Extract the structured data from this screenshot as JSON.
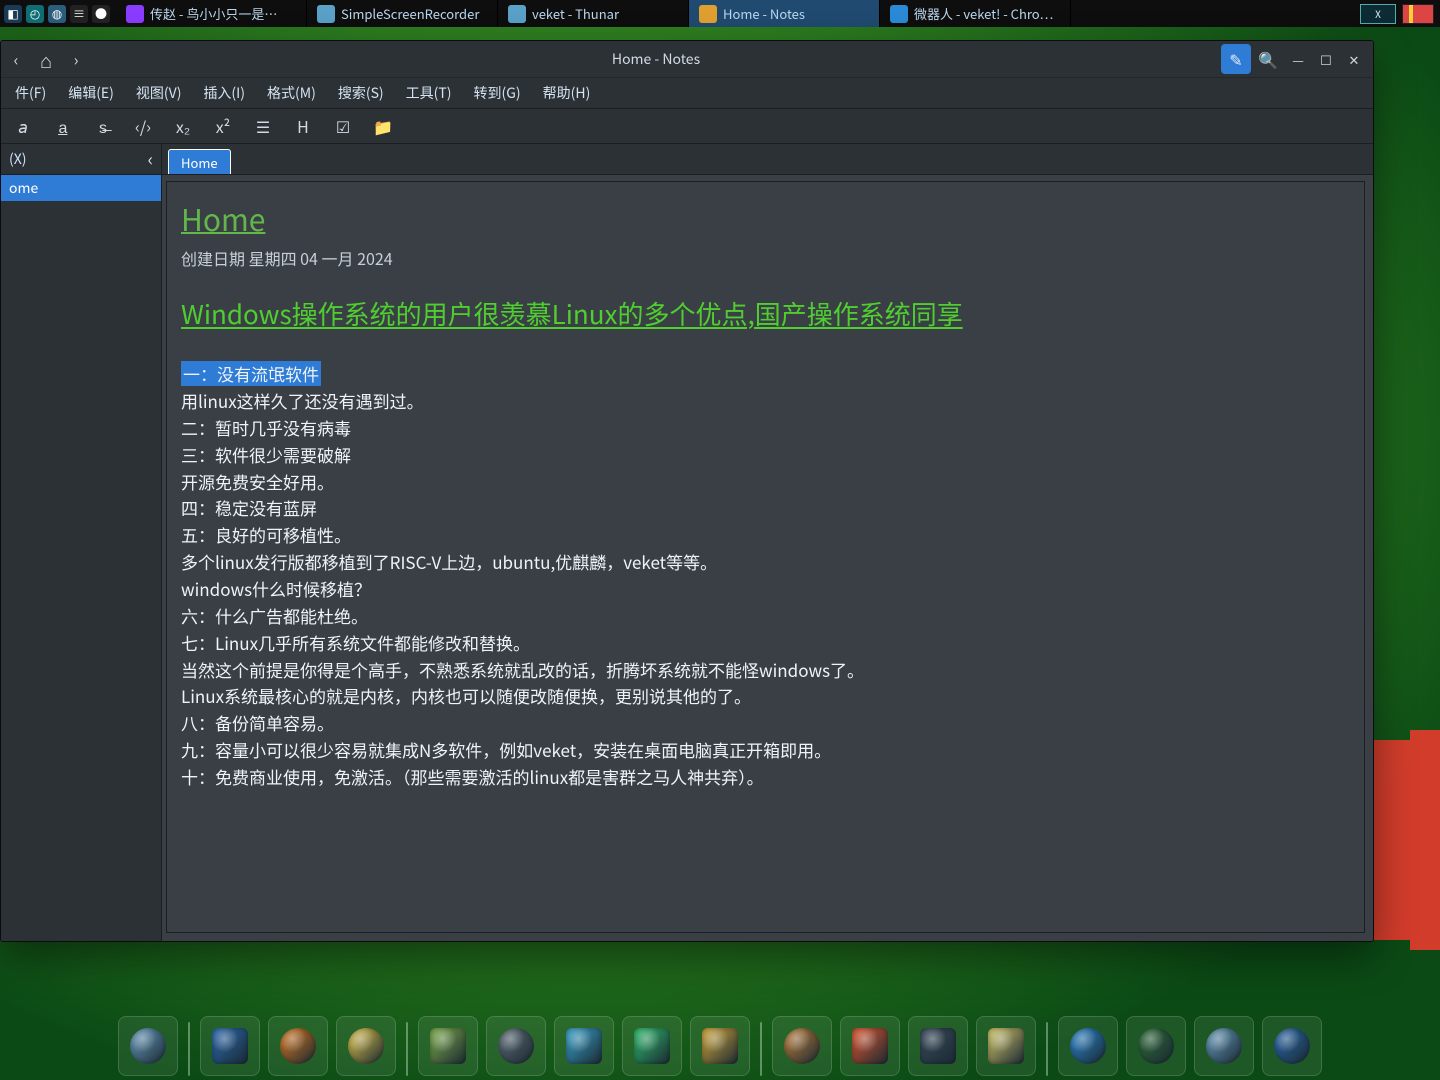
{
  "taskbar": {
    "tasks": [
      {
        "icon": "music-icon",
        "label": "传赵 - 鸟小小只一是…"
      },
      {
        "icon": "folder-icon",
        "label": "SimpleScreenRecorder"
      },
      {
        "icon": "folder-icon",
        "label": "veket - Thunar"
      },
      {
        "icon": "pencil-icon",
        "label": "Home - Notes",
        "active": true
      },
      {
        "icon": "chrome-icon",
        "label": "微器人 - veket! - Chro…"
      }
    ],
    "tray_mon": "X",
    "tray_flag": ""
  },
  "window": {
    "title": "Home - Notes",
    "nav_back_glyph": "‹",
    "nav_home_glyph": "⌂",
    "nav_fwd_glyph": "›",
    "edit_glyph": "✎",
    "search_glyph": "🔍",
    "min_glyph": "—",
    "max_glyph": "☐",
    "close_glyph": "✕"
  },
  "menu": [
    "件(F)",
    "编辑(E)",
    "视图(V)",
    "插入(I)",
    "格式(M)",
    "搜索(S)",
    "工具(T)",
    "转到(G)",
    "帮助(H)"
  ],
  "tools": [
    {
      "name": "italic-icon",
      "g": "𝘢"
    },
    {
      "name": "underline-icon",
      "g": "a̲"
    },
    {
      "name": "strike-icon",
      "g": "s̶"
    },
    {
      "name": "code-icon",
      "g": "‹/›"
    },
    {
      "name": "subscript-icon",
      "g": "x₂"
    },
    {
      "name": "superscript-icon",
      "g": "x²"
    },
    {
      "name": "list-icon",
      "g": "☰"
    },
    {
      "name": "heading-icon",
      "g": "H"
    },
    {
      "name": "task-icon",
      "g": "☑"
    },
    {
      "name": "folder-open-icon",
      "g": "📁"
    }
  ],
  "sidebar": {
    "tab_label": "(X)",
    "collapse_glyph": "‹",
    "items": [
      {
        "label": "ome",
        "selected": true
      }
    ]
  },
  "tabs": [
    {
      "label": "Home"
    }
  ],
  "doc": {
    "title": "Home",
    "date": "创建日期 星期四 04 一月 2024",
    "headline": "Windows操作系统的用户很羡慕Linux的多个优点,国产操作系统同享",
    "highlight": "一：没有流氓软件",
    "lines": [
      "用linux这样久了还没有遇到过。",
      "二：暂时几乎没有病毒",
      "三：软件很少需要破解",
      "开源免费安全好用。",
      "四：稳定没有蓝屏",
      "五：良好的可移植性。",
      "多个linux发行版都移植到了RISC-V上边，ubuntu,优麒麟，veket等等。",
      "windows什么时候移植？",
      "六：什么广告都能杜绝。",
      "七：Linux几乎所有系统文件都能修改和替换。",
      "当然这个前提是你得是个高手，不熟悉系统就乱改的话，折腾坏系统就不能怪windows了。",
      "Linux系统最核心的就是内核，内核也可以随便改随便换，更别说其他的了。",
      "八：备份简单容易。",
      "九：容量小可以很少容易就集成N多软件，例如veket，安装在桌面电脑真正开箱即用。",
      "十：免费商业使用，免激活。（那些需要激活的linux都是害群之马人神共弃）。"
    ]
  },
  "dock": {
    "count_groups": [
      1,
      3,
      5,
      4,
      4
    ]
  }
}
